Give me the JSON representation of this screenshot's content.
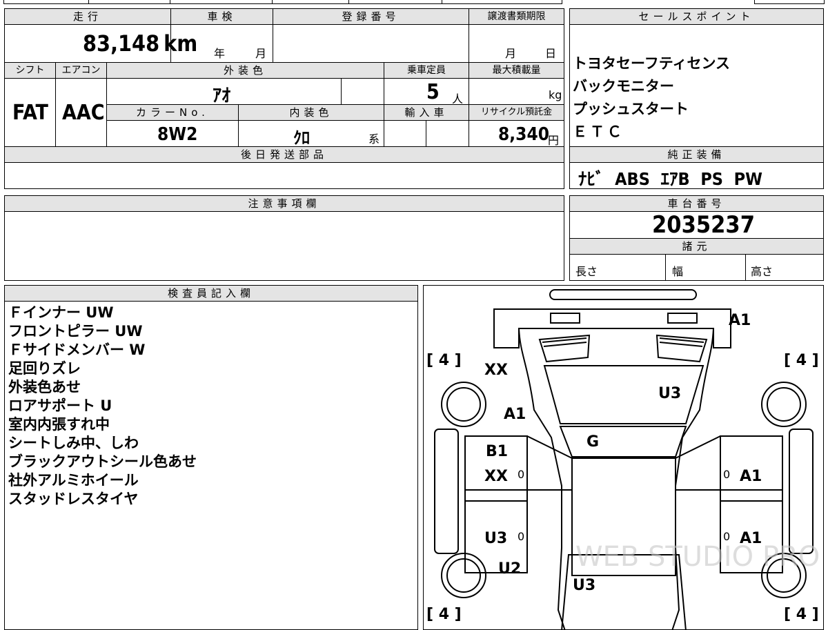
{
  "header": {
    "mileage_label": "走行",
    "inspection_label": "車検",
    "registration_label": "登録番号",
    "transfer_deadline_label": "譲渡書類期限",
    "sales_points_label": "セールスポイント"
  },
  "vehicle": {
    "mileage": "83,148",
    "mileage_unit": "km",
    "inspection_year_unit": "年",
    "inspection_month_unit": "月",
    "deadline_month_unit": "月",
    "deadline_day_unit": "日",
    "shift_label": "シフト",
    "shift": "FAT",
    "aircon_label": "エアコン",
    "aircon": "AAC",
    "exterior_color_label": "外装色",
    "exterior_color": "ｱｵ",
    "capacity_label": "乗車定員",
    "capacity": "5",
    "capacity_unit": "人",
    "max_load_label": "最大積載量",
    "max_load_unit": "kg",
    "color_no_label": "カラーNo.",
    "color_no": "8W2",
    "interior_color_label": "内装色",
    "interior_color": "ｸﾛ",
    "interior_color_suffix": "系",
    "import_label": "輸入車",
    "recycle_label": "リサイクル預託金",
    "recycle_fee": "8,340",
    "recycle_unit": "円",
    "later_parts_label": "後日発送部品"
  },
  "sales_points": [
    "トヨタセーフティセンス",
    "バックモニター",
    "プッシュスタート",
    "ＥＴＣ"
  ],
  "genuine_equipment_label": "純正装備",
  "genuine_equipment": "ﾅﾋﾞ  ABS  ｴｱB  PS  PW",
  "notes_label": "注意事項欄",
  "chassis_label": "車台番号",
  "chassis_number": "2035237",
  "specs_label": "諸元",
  "specs": {
    "length": "長さ",
    "width": "幅",
    "height": "高さ"
  },
  "inspector_label": "検査員記入欄",
  "inspector_notes": [
    "Ｆインナー UW",
    "フロントピラー UW",
    "Ｆサイドメンバー W",
    "足回りズレ",
    "外装色あせ",
    "ロアサポート U",
    "室内内張すれ中",
    "シートしみ中、しわ",
    "ブラックアウトシール色あせ",
    "社外アルミホイール",
    "スタッドレスタイヤ"
  ],
  "diagram": {
    "tire_fl": "[ 4 ]",
    "tire_fr": "[ 4 ]",
    "tire_rl": "[ 4 ]",
    "tire_rr": "[ 4 ]",
    "bumper_front": "A1",
    "fender_left_front": "XX",
    "fender_left_mid": "A1",
    "hood": "U3",
    "roof_front": "G",
    "door_left_front_a": "B1",
    "door_left_front_b": "XX",
    "door_right_front": "A1",
    "door_left_rear": "U3",
    "door_right_rear": "A1",
    "quarter_left": "U2",
    "trunk": "U3",
    "zero_marks": [
      "0",
      "0",
      "0",
      "0"
    ],
    "watermark": "WEB STUDIO PRO"
  }
}
